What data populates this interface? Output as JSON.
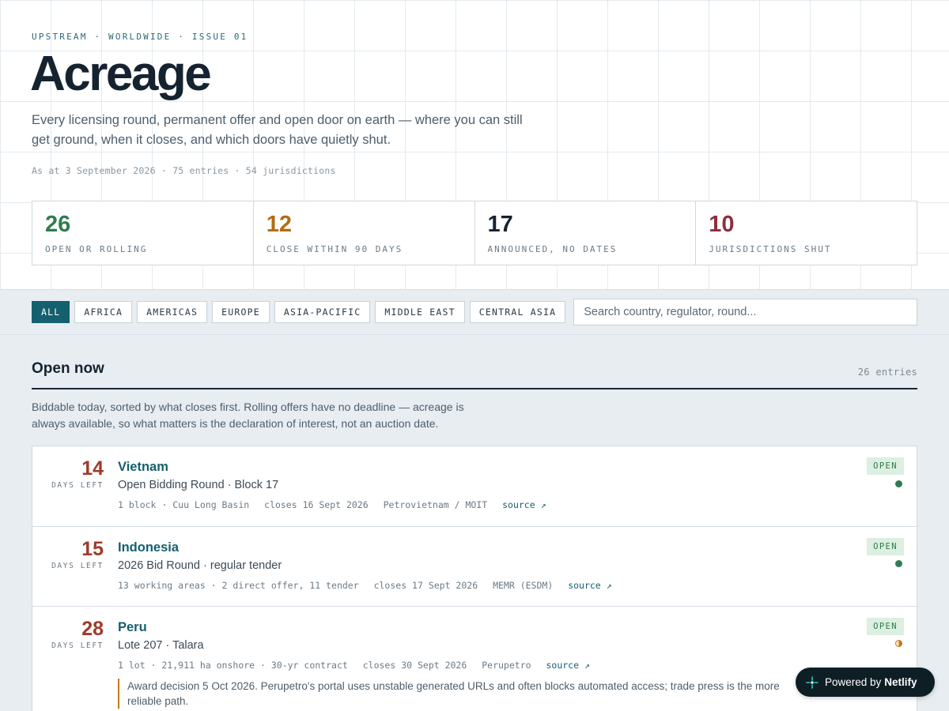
{
  "header": {
    "kicker": "UPSTREAM · WORLDWIDE · ISSUE 01",
    "title": "Acreage",
    "lede": "Every licensing round, permanent offer and open door on earth — where you can still get ground, when it closes, and which doors have quietly shut.",
    "as_at": "As at 3 September 2026 · 75 entries · 54 jurisdictions"
  },
  "stats": [
    {
      "value": "26",
      "label": "OPEN OR ROLLING",
      "color": "#2e7d4f"
    },
    {
      "value": "12",
      "label": "CLOSE WITHIN 90 DAYS",
      "color": "#b36b10"
    },
    {
      "value": "17",
      "label": "ANNOUNCED, NO DATES",
      "color": "#152330"
    },
    {
      "value": "10",
      "label": "JURISDICTIONS SHUT",
      "color": "#8c2f3f"
    }
  ],
  "filters": {
    "chips": [
      "ALL",
      "AFRICA",
      "AMERICAS",
      "EUROPE",
      "ASIA-PACIFIC",
      "MIDDLE EAST",
      "CENTRAL ASIA"
    ],
    "active": "ALL",
    "search_placeholder": "Search country, regulator, round..."
  },
  "section": {
    "title": "Open now",
    "count": "26 entries",
    "description": "Biddable today, sorted by what closes first. Rolling offers have no deadline — acreage is always available, so what matters is the declaration of interest, not an auction date."
  },
  "entries": [
    {
      "days": "14",
      "days_unit": "DAYS LEFT",
      "country": "Vietnam",
      "round": "Open Bidding Round · Block 17",
      "meta": [
        "1 block · Cuu Long Basin",
        "closes 16 Sept 2026",
        "Petrovietnam / MOIT"
      ],
      "source": "source ↗",
      "status": "OPEN"
    },
    {
      "days": "15",
      "days_unit": "DAYS LEFT",
      "country": "Indonesia",
      "round": "2026 Bid Round · regular tender",
      "meta": [
        "13 working areas · 2 direct offer, 11 tender",
        "closes 17 Sept 2026",
        "MEMR (ESDM)"
      ],
      "source": "source ↗",
      "status": "OPEN"
    },
    {
      "days": "28",
      "days_unit": "DAYS LEFT",
      "country": "Peru",
      "round": "Lote 207 · Talara",
      "meta": [
        "1 lot · 21,911 ha onshore · 30-yr contract",
        "closes 30 Sept 2026",
        "Perupetro"
      ],
      "source": "source ↗",
      "status": "OPEN",
      "note": "Award decision 5 Oct 2026. Perupetro's portal uses unstable generated URLs and often blocks automated access; trade press is the more reliable path."
    }
  ],
  "netlify": {
    "prefix": "Powered by",
    "brand": "Netlify"
  }
}
